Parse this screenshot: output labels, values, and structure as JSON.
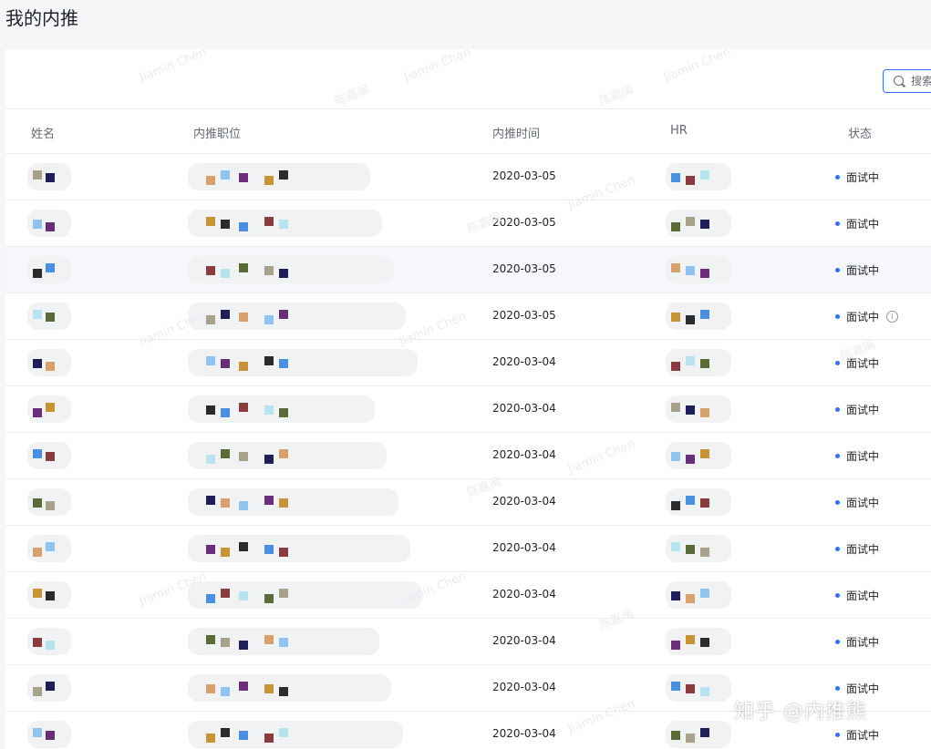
{
  "page_title": "我的内推",
  "search": {
    "placeholder": "搜索"
  },
  "table": {
    "columns": [
      "姓名",
      "内推职位",
      "内推时间",
      "HR",
      "状态"
    ],
    "rows": [
      {
        "date": "2020-03-05",
        "status": "面试中"
      },
      {
        "date": "2020-03-05",
        "status": "面试中"
      },
      {
        "date": "2020-03-05",
        "status": "面试中"
      },
      {
        "date": "2020-03-05",
        "status": "面试中"
      },
      {
        "date": "2020-03-04",
        "status": "面试中"
      },
      {
        "date": "2020-03-04",
        "status": "面试中"
      },
      {
        "date": "2020-03-04",
        "status": "面试中"
      },
      {
        "date": "2020-03-04",
        "status": "面试中"
      },
      {
        "date": "2020-03-04",
        "status": "面试中"
      },
      {
        "date": "2020-03-04",
        "status": "面试中"
      },
      {
        "date": "2020-03-04",
        "status": "面试中"
      },
      {
        "date": "2020-03-04",
        "status": "面试中"
      },
      {
        "date": "2020-03-04",
        "status": "面试中"
      }
    ]
  },
  "colors": {
    "accent": "#3370ff",
    "status_dot": "#3370ff"
  },
  "watermark_text": [
    "Jiamin Chen",
    "陈嘉闽"
  ],
  "brand_watermark": "知乎 @内推熊"
}
